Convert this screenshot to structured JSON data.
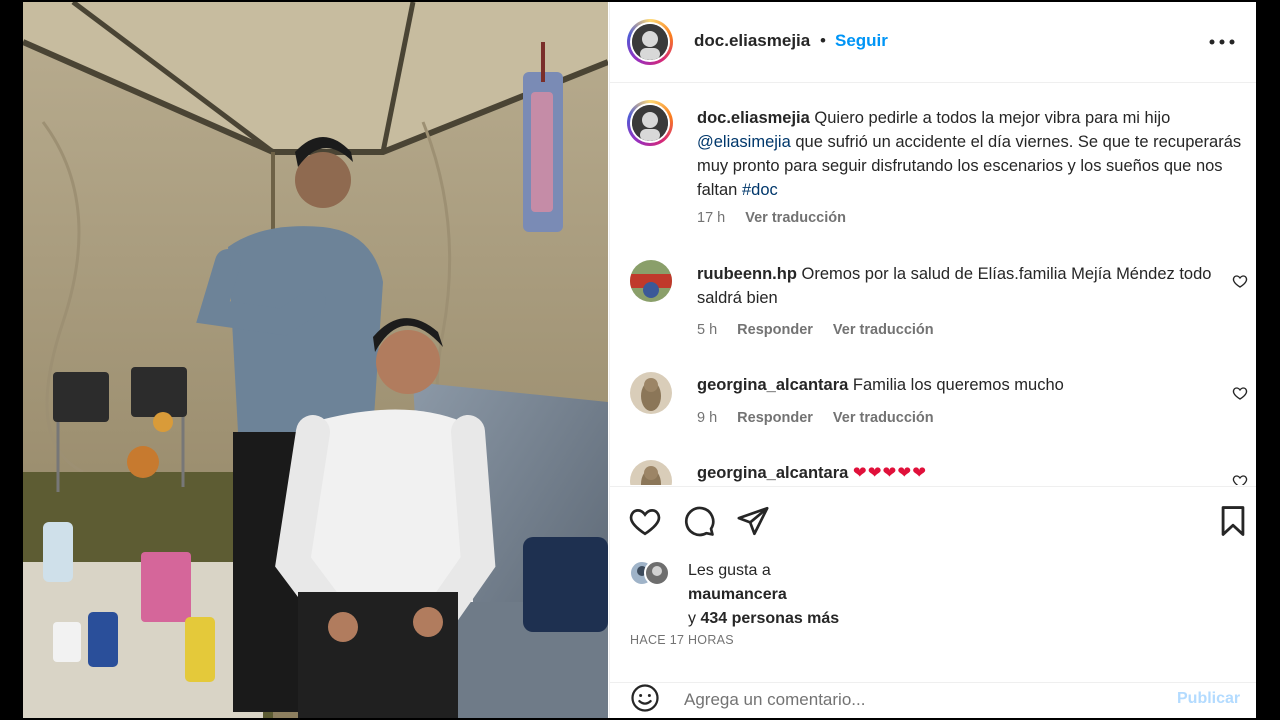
{
  "post": {
    "username": "doc.eliasmejia",
    "dot": "•",
    "follow_label": "Seguir",
    "more_icon": "more-horizontal-icon"
  },
  "caption": {
    "username": "doc.eliasmejia",
    "text_1": "Quiero pedirle a todos la mejor vibra para mi hijo",
    "mention": "@eliasimejia",
    "text_2": "que sufrió un accidente el día viernes. Se que te recuperarás muy pronto para seguir disfrutando los escenarios y los sueños que nos faltan",
    "hashtag": "#doc",
    "time": "17 h",
    "translate": "Ver traducción"
  },
  "comments": [
    {
      "username": "ruubeenn.hp",
      "text": "Oremos por la salud de Elías.familia Mejía Méndez todo saldrá bien",
      "time": "5 h",
      "reply": "Responder",
      "translate": "Ver traducción"
    },
    {
      "username": "georgina_alcantara",
      "text": "Familia los queremos mucho",
      "time": "9 h",
      "reply": "Responder",
      "translate": "Ver traducción"
    },
    {
      "username": "georgina_alcantara",
      "text": "❤❤❤❤❤"
    }
  ],
  "likes": {
    "prefix": "Les gusta a",
    "first_user": "maumancera",
    "y": "y",
    "others": "434 personas más"
  },
  "time_ago": "HACE 17 HORAS",
  "add_comment": {
    "placeholder": "Agrega un comentario...",
    "publish_label": "Publicar"
  },
  "colors": {
    "accent": "#0095f6",
    "link": "#00376b",
    "heart": "#e0103a",
    "muted": "#737373"
  }
}
